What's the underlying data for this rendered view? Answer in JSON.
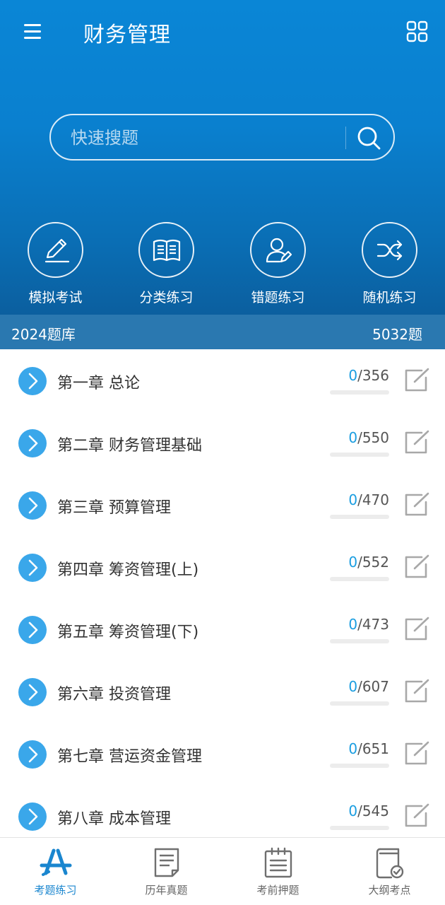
{
  "header": {
    "title": "财务管理",
    "menu_icon": "hamburger-menu-icon",
    "apps_icon": "grid-apps-icon",
    "background_color": "#0a80cf"
  },
  "search": {
    "placeholder": "快速搜题",
    "icon": "search-icon"
  },
  "features": [
    {
      "label": "模拟考试",
      "icon": "pencil-icon"
    },
    {
      "label": "分类练习",
      "icon": "open-book-icon"
    },
    {
      "label": "错题练习",
      "icon": "user-edit-icon"
    },
    {
      "label": "随机练习",
      "icon": "shuffle-icon"
    }
  ],
  "bank": {
    "label": "2024题库",
    "total": "5032题",
    "bar_color": "#2a78b0"
  },
  "chapters": [
    {
      "title": "第一章 总论",
      "done": "0",
      "total": "/356"
    },
    {
      "title": "第二章 财务管理基础",
      "done": "0",
      "total": "/550"
    },
    {
      "title": "第三章 预算管理",
      "done": "0",
      "total": "/470"
    },
    {
      "title": "第四章 筹资管理(上)",
      "done": "0",
      "total": "/552"
    },
    {
      "title": "第五章 筹资管理(下)",
      "done": "0",
      "total": "/473"
    },
    {
      "title": "第六章 投资管理",
      "done": "0",
      "total": "/607"
    },
    {
      "title": "第七章 营运资金管理",
      "done": "0",
      "total": "/651"
    },
    {
      "title": "第八章 成本管理",
      "done": "0",
      "total": "/545"
    }
  ],
  "tabs": [
    {
      "label": "考题练习",
      "icon": "app-store-a-icon",
      "active": true
    },
    {
      "label": "历年真题",
      "icon": "document-icon",
      "active": false
    },
    {
      "label": "考前押题",
      "icon": "notepad-icon",
      "active": false
    },
    {
      "label": "大纲考点",
      "icon": "book-check-icon",
      "active": false
    }
  ],
  "colors": {
    "accent": "#1a9de0",
    "tab_active": "#1a86cf",
    "chapter_arrow": "#3aa7ea"
  }
}
